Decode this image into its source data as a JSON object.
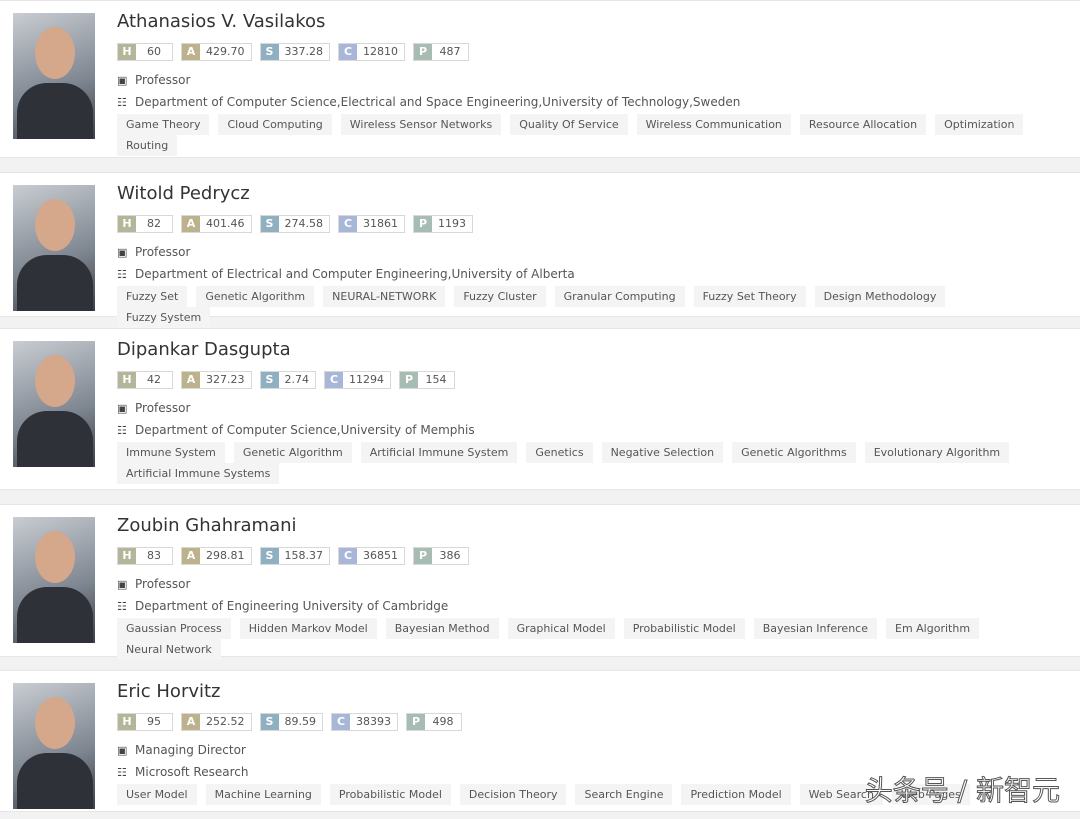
{
  "badge_colors": {
    "H": "#b5b59a",
    "A": "#bcb28e",
    "S": "#8fb0c0",
    "C": "#a8b6d8",
    "P": "#a7bcb2"
  },
  "badge_keys": [
    "H",
    "A",
    "S",
    "C",
    "P"
  ],
  "people": [
    {
      "name": "Athanasios V. Vasilakos",
      "stats": [
        "60",
        "429.70",
        "337.28",
        "12810",
        "487"
      ],
      "role": "Professor",
      "affiliation": "Department of Computer Science,Electrical and Space Engineering,University of Technology,Sweden",
      "tags": [
        "Game Theory",
        "Cloud Computing",
        "Wireless Sensor Networks",
        "Quality Of Service",
        "Wireless Communication",
        "Resource Allocation",
        "Optimization",
        "Routing"
      ]
    },
    {
      "name": "Witold Pedrycz",
      "stats": [
        "82",
        "401.46",
        "274.58",
        "31861",
        "1193"
      ],
      "role": "Professor",
      "affiliation": "Department of Electrical and Computer Engineering,University of Alberta",
      "tags": [
        "Fuzzy Set",
        "Genetic Algorithm",
        "NEURAL-NETWORK",
        "Fuzzy Cluster",
        "Granular Computing",
        "Fuzzy Set Theory",
        "Design Methodology",
        "Fuzzy System"
      ]
    },
    {
      "name": "Dipankar Dasgupta",
      "stats": [
        "42",
        "327.23",
        "2.74",
        "11294",
        "154"
      ],
      "role": "Professor",
      "affiliation": "Department of Computer Science,University of Memphis",
      "tags": [
        "Immune System",
        "Genetic Algorithm",
        "Artificial Immune System",
        "Genetics",
        "Negative Selection",
        "Genetic Algorithms",
        "Evolutionary Algorithm",
        "Artificial Immune Systems"
      ]
    },
    {
      "name": "Zoubin Ghahramani",
      "stats": [
        "83",
        "298.81",
        "158.37",
        "36851",
        "386"
      ],
      "role": "Professor",
      "affiliation": "Department of Engineering University of Cambridge",
      "tags": [
        "Gaussian Process",
        "Hidden Markov Model",
        "Bayesian Method",
        "Graphical Model",
        "Probabilistic Model",
        "Bayesian Inference",
        "Em Algorithm",
        "Neural Network"
      ]
    },
    {
      "name": "Eric Horvitz",
      "stats": [
        "95",
        "252.52",
        "89.59",
        "38393",
        "498"
      ],
      "role": "Managing Director",
      "affiliation": "Microsoft Research",
      "tags": [
        "User Model",
        "Machine Learning",
        "Probabilistic Model",
        "Decision Theory",
        "Search Engine",
        "Prediction Model",
        "Web Search",
        "Web Pages"
      ]
    }
  ],
  "watermark": "头条号 / 新智元"
}
